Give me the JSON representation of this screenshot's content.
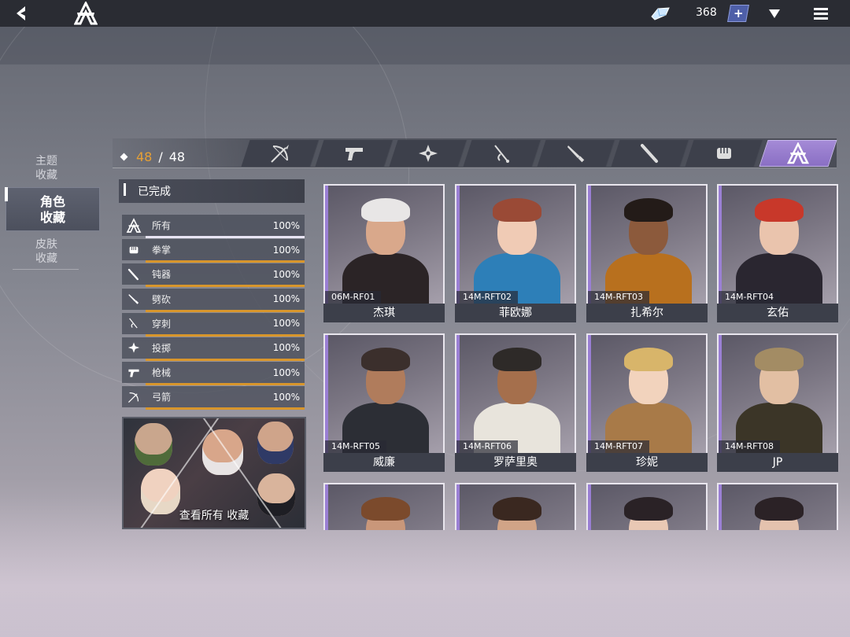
{
  "topbar": {
    "currency_amount": "368",
    "plus_label": "+"
  },
  "categories": [
    {
      "label_line1": "主题",
      "label_line2": "收藏"
    },
    {
      "label_line1": "角色",
      "label_line2": "收藏"
    },
    {
      "label_line1": "皮肤",
      "label_line2": "收藏"
    }
  ],
  "collection": {
    "current": "48",
    "separator": "/",
    "total": "48"
  },
  "tabs": [
    {
      "icon": "bow-icon"
    },
    {
      "icon": "gun-icon"
    },
    {
      "icon": "shuriken-icon"
    },
    {
      "icon": "pierce-icon"
    },
    {
      "icon": "blade-icon"
    },
    {
      "icon": "club-icon"
    },
    {
      "icon": "fist-icon"
    },
    {
      "icon": "all-emblem-icon"
    }
  ],
  "status_header": "已完成",
  "stats": [
    {
      "icon": "all-emblem-icon",
      "label": "所有",
      "percent": "100%",
      "progress": 1.0
    },
    {
      "icon": "fist-icon",
      "label": "拳掌",
      "percent": "100%",
      "progress": 1.0
    },
    {
      "icon": "club-icon",
      "label": "钝器",
      "percent": "100%",
      "progress": 1.0
    },
    {
      "icon": "blade-icon",
      "label": "劈砍",
      "percent": "100%",
      "progress": 1.0
    },
    {
      "icon": "pierce-icon",
      "label": "穿刺",
      "percent": "100%",
      "progress": 1.0
    },
    {
      "icon": "shuriken-icon",
      "label": "投掷",
      "percent": "100%",
      "progress": 1.0
    },
    {
      "icon": "gun-icon",
      "label": "枪械",
      "percent": "100%",
      "progress": 1.0
    },
    {
      "icon": "bow-icon",
      "label": "弓箭",
      "percent": "100%",
      "progress": 1.0
    }
  ],
  "view_all_label": "查看所有 收藏",
  "characters": [
    {
      "code": "06M-RF01",
      "name": "杰琪",
      "hair": "#e8e6e6",
      "skin": "#d9a88b",
      "outfit": "#2b2426"
    },
    {
      "code": "14M-RFT02",
      "name": "菲欧娜",
      "hair": "#9a4a36",
      "skin": "#f0cbb5",
      "outfit": "#2d7fb8"
    },
    {
      "code": "14M-RFT03",
      "name": "扎希尔",
      "hair": "#231b18",
      "skin": "#8c5a3c",
      "outfit": "#b8701e"
    },
    {
      "code": "14M-RFT04",
      "name": "玄佑",
      "hair": "#c8382a",
      "skin": "#eac4ad",
      "outfit": "#2a2630"
    },
    {
      "code": "14M-RFT05",
      "name": "威廉",
      "hair": "#3b2f2c",
      "skin": "#b07c5c",
      "outfit": "#2c2e35"
    },
    {
      "code": "14M-RFT06",
      "name": "罗萨里奥",
      "hair": "#2e2a28",
      "skin": "#a56f4c",
      "outfit": "#e8e4dc"
    },
    {
      "code": "14M-RFT07",
      "name": "珍妮",
      "hair": "#d8b56a",
      "skin": "#f2d3bd",
      "outfit": "#a87a48"
    },
    {
      "code": "14M-RFT08",
      "name": "JP",
      "hair": "#a38c64",
      "skin": "#e2bfa3",
      "outfit": "#3b3527"
    },
    {
      "code": "",
      "name": "",
      "hair": "#7b4a2c",
      "skin": "#c9977a",
      "outfit": "#4a3a34"
    },
    {
      "code": "",
      "name": "",
      "hair": "#3a2820",
      "skin": "#d1a487",
      "outfit": "#5a4a48"
    },
    {
      "code": "",
      "name": "",
      "hair": "#2a2226",
      "skin": "#e9c8b4",
      "outfit": "#3c3440"
    },
    {
      "code": "",
      "name": "",
      "hair": "#2b2226",
      "skin": "#e4c2ae",
      "outfit": "#6a4a3a"
    }
  ]
}
